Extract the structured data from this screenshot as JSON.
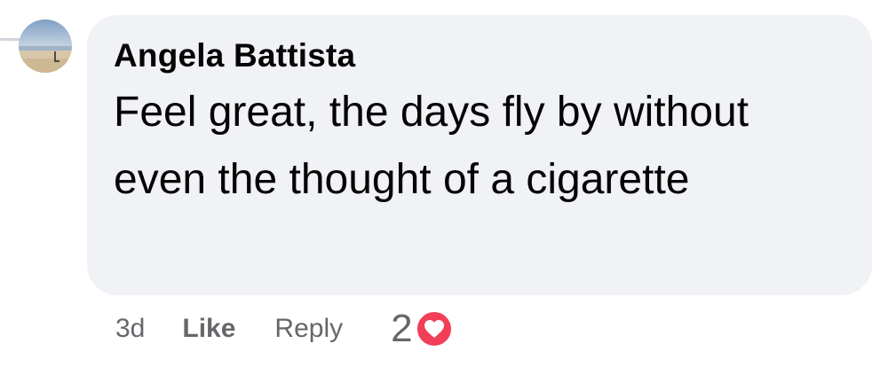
{
  "comment": {
    "author": "Angela Battista",
    "text": "Feel great, the days fly by without even the thought of a cigarette",
    "time": "3d",
    "like_label": "Like",
    "reply_label": "Reply",
    "reaction_count": "2",
    "reaction_icon": "heart-icon",
    "reaction_color": "#f33e58"
  }
}
